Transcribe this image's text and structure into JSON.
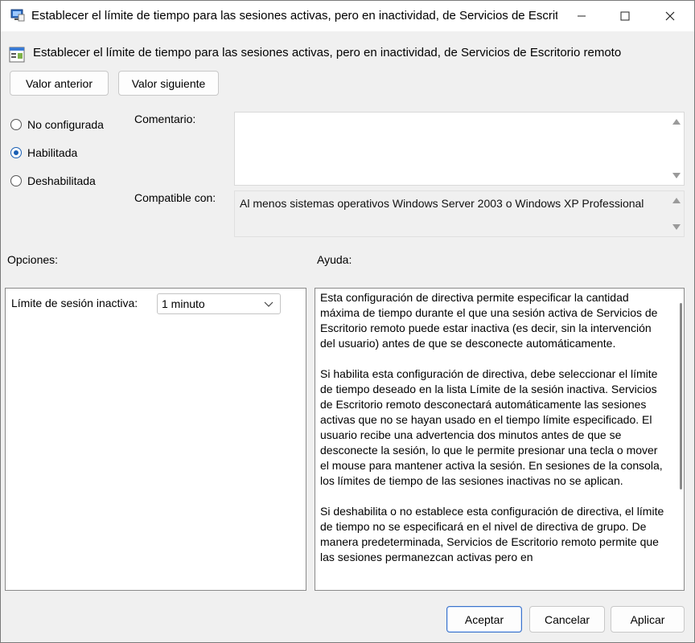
{
  "window": {
    "title": "Establecer el límite de tiempo para las sesiones activas, pero en inactividad, de Servicios de Escrito..."
  },
  "header": {
    "title": "Establecer el límite de tiempo para las sesiones activas, pero en inactividad, de Servicios de Escritorio remoto"
  },
  "nav": {
    "prev_label": "Valor anterior",
    "next_label": "Valor siguiente"
  },
  "state": {
    "not_configured": "No configurada",
    "enabled": "Habilitada",
    "disabled": "Deshabilitada",
    "selected": "Habilitada"
  },
  "comment": {
    "label": "Comentario:",
    "value": ""
  },
  "compat": {
    "label": "Compatible con:",
    "value": "Al menos sistemas operativos Windows Server 2003 o Windows XP Professional"
  },
  "options": {
    "title": "Opciones:",
    "limit_label": "Límite de sesión inactiva:",
    "limit_value": "1 minuto"
  },
  "help": {
    "title": "Ayuda:",
    "paragraphs": [
      "Esta configuración de directiva permite especificar la cantidad máxima de tiempo durante el que una sesión activa de Servicios de Escritorio remoto puede estar inactiva (es decir, sin la intervención del usuario) antes de que se desconecte automáticamente.",
      "Si habilita esta configuración de directiva, debe seleccionar el límite de tiempo deseado en la lista Límite de la sesión inactiva. Servicios de Escritorio remoto desconectará automáticamente las sesiones activas que no se hayan usado en el tiempo límite especificado. El usuario recibe una advertencia dos minutos antes de que se desconecte la sesión, lo que le permite presionar una tecla o mover el mouse para mantener activa la sesión. En sesiones de la consola, los límites de tiempo de las sesiones inactivas no se aplican.",
      "Si deshabilita o no establece esta configuración de directiva, el límite de tiempo no se especificará en el nivel de directiva de grupo. De manera predeterminada, Servicios de Escritorio remoto permite que las sesiones permanezcan activas pero en"
    ]
  },
  "footer": {
    "accept_label": "Aceptar",
    "cancel_label": "Cancelar",
    "apply_label": "Aplicar"
  },
  "colors": {
    "accent": "#1a5fb4",
    "background": "#f0f0f0"
  }
}
